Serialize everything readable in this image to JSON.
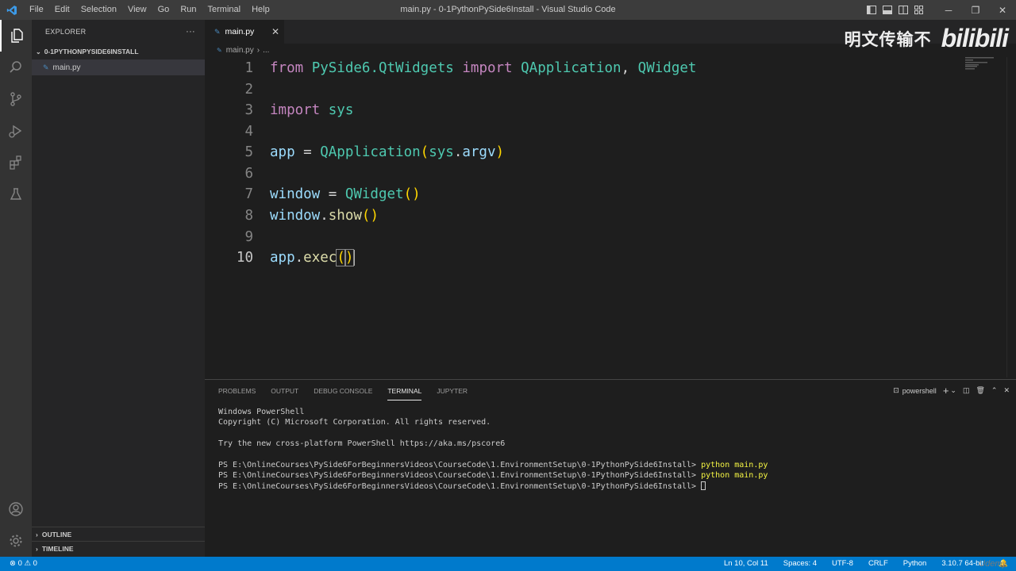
{
  "window": {
    "title": "main.py - 0-1PythonPySide6Install - Visual Studio Code",
    "menu": [
      "File",
      "Edit",
      "Selection",
      "View",
      "Go",
      "Run",
      "Terminal",
      "Help"
    ]
  },
  "sidebar": {
    "header": "EXPLORER",
    "more": "···",
    "folder": "0-1PYTHONPYSIDE6INSTALL",
    "file": "main.py",
    "outline": "OUTLINE",
    "timeline": "TIMELINE"
  },
  "editor": {
    "tab": "main.py",
    "close": "✕",
    "breadcrumb_file": "main.py",
    "breadcrumb_more": "...",
    "line_numbers": [
      "1",
      "2",
      "3",
      "4",
      "5",
      "6",
      "7",
      "8",
      "9",
      "10"
    ],
    "code": {
      "l1": {
        "from": "from",
        "mod": "PySide6.QtWidgets",
        "import": "import",
        "c1": "QApplication",
        "comma": ",",
        "c2": "QWidget"
      },
      "l3": {
        "import": "import",
        "mod": "sys"
      },
      "l5": {
        "var": "app",
        "eq": " = ",
        "cls": "QApplication",
        "op": "(",
        "a1": "sys",
        "dot": ".",
        "a2": "argv",
        "cp": ")"
      },
      "l7": {
        "var": "window",
        "eq": " = ",
        "cls": "QWidget",
        "op": "(",
        "cp": ")"
      },
      "l8": {
        "var": "window",
        "dot": ".",
        "fn": "show",
        "op": "(",
        "cp": ")"
      },
      "l10": {
        "var": "app",
        "dot": ".",
        "fn": "exec",
        "op": "(",
        "cp": ")"
      }
    }
  },
  "panel": {
    "tabs": [
      "PROBLEMS",
      "OUTPUT",
      "DEBUG CONSOLE",
      "TERMINAL",
      "JUPYTER"
    ],
    "active_tab": "TERMINAL",
    "shell": "powershell",
    "terminal": {
      "line1": "Windows PowerShell",
      "line2": "Copyright (C) Microsoft Corporation. All rights reserved.",
      "line3": "Try the new cross-platform PowerShell https://aka.ms/pscore6",
      "prompt": "PS E:\\OnlineCourses\\PySide6ForBeginnersVideos\\CourseCode\\1.EnvironmentSetup\\0-1PythonPySide6Install>",
      "cmd": "python main.py"
    }
  },
  "status": {
    "left": "⊗ 0 ⚠ 0",
    "position": "Ln 10, Col 11",
    "spaces": "Spaces: 4",
    "encoding": "UTF-8",
    "eol": "CRLF",
    "language": "Python",
    "interpreter": "3.10.7 64-bit"
  },
  "overlay": {
    "watermark_text": "明文传输不",
    "watermark_logo": "bilibili",
    "udemy": "Udemy"
  },
  "colors": {
    "accent": "#007acc",
    "keyword": "#c586c0",
    "class": "#4ec9b0",
    "variable": "#9cdcfe",
    "function": "#dcdcaa",
    "bracket": "#ffd700"
  }
}
